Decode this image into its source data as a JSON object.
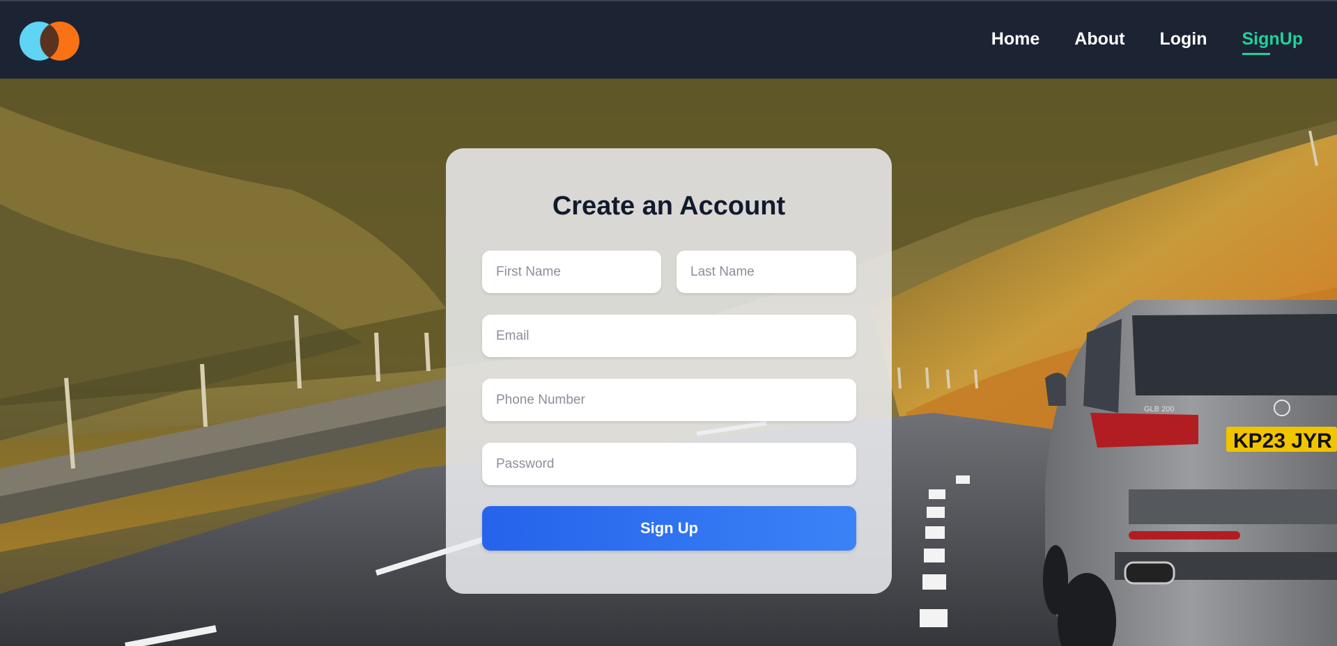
{
  "brand": {
    "logo_icon": "two-overlapping-circles-logo",
    "colors": {
      "left": "#5fd4f4",
      "right": "#f97316",
      "overlap": "#5a3320"
    }
  },
  "nav": {
    "items": [
      {
        "label": "Home",
        "active": false
      },
      {
        "label": "About",
        "active": false
      },
      {
        "label": "Login",
        "active": false
      },
      {
        "label": "SignUp",
        "active": true
      }
    ],
    "active_color": "#1fd29a",
    "background": "#1c2433"
  },
  "form": {
    "title": "Create an Account",
    "fields": {
      "first_name": {
        "placeholder": "First Name",
        "value": ""
      },
      "last_name": {
        "placeholder": "Last Name",
        "value": ""
      },
      "email": {
        "placeholder": "Email",
        "value": ""
      },
      "phone": {
        "placeholder": "Phone Number",
        "value": ""
      },
      "password": {
        "placeholder": "Password",
        "value": ""
      }
    },
    "submit_label": "Sign Up",
    "button_color": "#2563eb"
  },
  "hero": {
    "background_icon": "mountain-road-car-photo",
    "license_plate": "KP23 JYR",
    "car_badge": "GLB 200"
  }
}
